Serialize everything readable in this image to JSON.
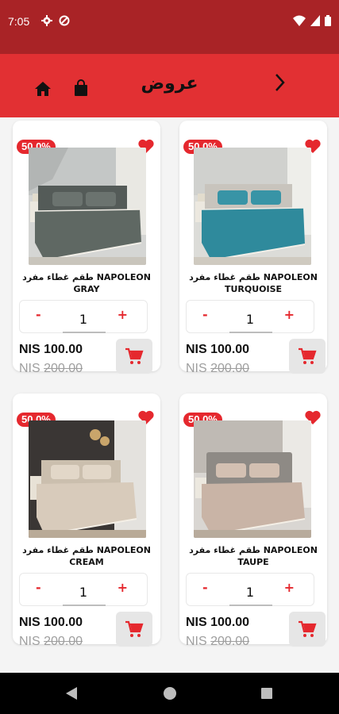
{
  "status_bar": {
    "time": "7:05"
  },
  "app_bar": {
    "title": "عروض"
  },
  "products": [
    {
      "discount": "50.0%",
      "name_line1": "طقم غطاء مفرد NAPOLEON",
      "name_line2": "GRAY",
      "quantity": "1",
      "price": "NIS 100.00",
      "old_price_currency": "NIS ",
      "old_price_value": "200.00",
      "qty_minus": "-",
      "qty_plus": "+"
    },
    {
      "discount": "50.0%",
      "name_line1": "طقم غطاء مفرد NAPOLEON",
      "name_line2": "TURQUOISE",
      "quantity": "1",
      "price": "NIS 100.00",
      "old_price_currency": "NIS ",
      "old_price_value": "200.00",
      "qty_minus": "-",
      "qty_plus": "+"
    },
    {
      "discount": "50.0%",
      "name_line1": "طقم غطاء مفرد NAPOLEON",
      "name_line2": "CREAM",
      "quantity": "1",
      "price": "NIS 100.00",
      "old_price_currency": "NIS ",
      "old_price_value": "200.00",
      "qty_minus": "-",
      "qty_plus": "+"
    },
    {
      "discount": "50.0%",
      "name_line1": "طقم غطاء مفرد NAPOLEON",
      "name_line2": "TAUPE",
      "quantity": "1",
      "price": "NIS 100.00",
      "old_price_currency": "NIS ",
      "old_price_value": "200.00",
      "qty_minus": "-",
      "qty_plus": "+"
    }
  ],
  "colors": {
    "accent": "#e5282e",
    "app_bar": "#e23033",
    "status_bar": "#a92326",
    "bedding_gray": "#5f6863",
    "bedding_turquoise": "#2f8a9c",
    "bedding_cream": "#d8cbbb",
    "bedding_taupe": "#c9b4a6"
  }
}
